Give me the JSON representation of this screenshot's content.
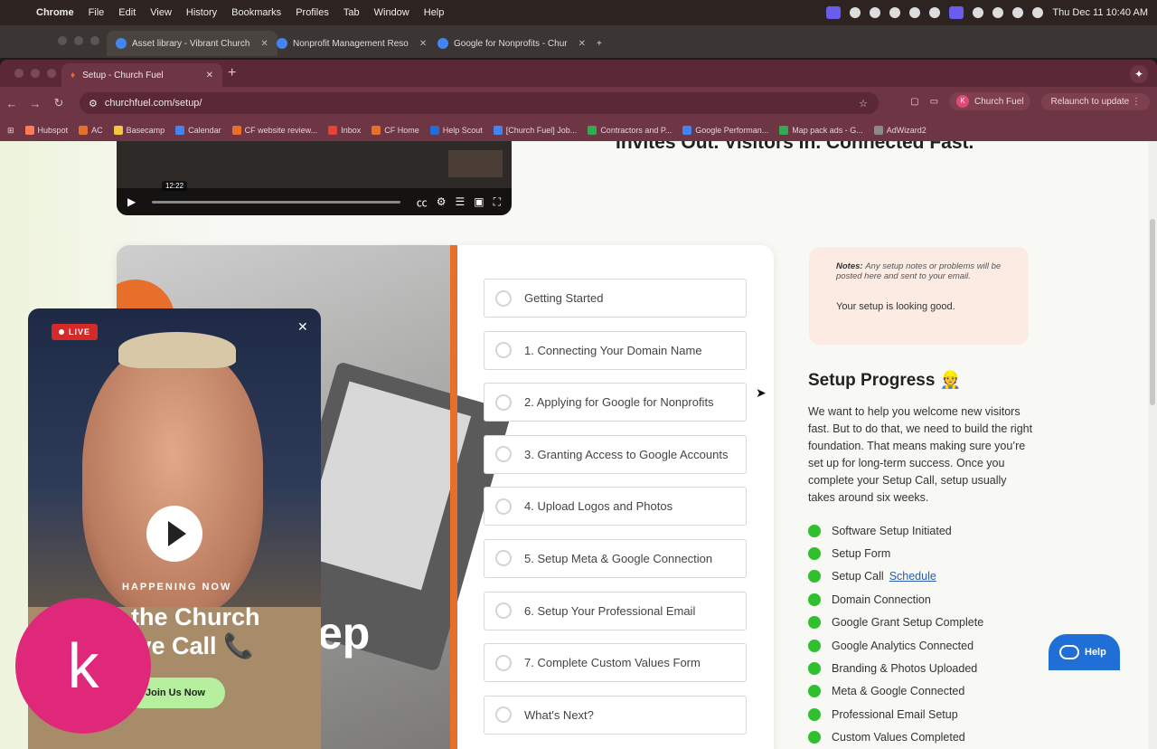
{
  "menubar": {
    "items": [
      "Chrome",
      "File",
      "Edit",
      "View",
      "History",
      "Bookmarks",
      "Profiles",
      "Tab",
      "Window",
      "Help"
    ],
    "datetime": "Thu Dec 11  10:40 AM"
  },
  "back_window_tabs": [
    {
      "title": "Asset library - Vibrant Church",
      "color": "#4285f4"
    },
    {
      "title": "Nonprofit Management Reso",
      "color": "#4285f4"
    },
    {
      "title": "Google for Nonprofits - Chur",
      "color": "#4285f4"
    }
  ],
  "tab": {
    "title": "Setup - Church Fuel"
  },
  "toolbar": {
    "url": "churchfuel.com/setup/",
    "profile_initial": "K",
    "profile_name": "Church Fuel",
    "relaunch": "Relaunch to update"
  },
  "bookmarks": [
    {
      "label": "Hubspot",
      "color": "#ff7a59"
    },
    {
      "label": "AC",
      "color": "#e86e2c"
    },
    {
      "label": "Basecamp",
      "color": "#f5c542"
    },
    {
      "label": "Calendar",
      "color": "#4285f4"
    },
    {
      "label": "CF website review...",
      "color": "#e86e2c"
    },
    {
      "label": "Inbox",
      "color": "#ea4335"
    },
    {
      "label": "CF Home",
      "color": "#e86e2c"
    },
    {
      "label": "Help Scout",
      "color": "#1f6fd6"
    },
    {
      "label": "[Church Fuel] Job...",
      "color": "#4285f4"
    },
    {
      "label": "Contractors and P...",
      "color": "#34a853"
    },
    {
      "label": "Google Performan...",
      "color": "#4285f4"
    },
    {
      "label": "Map pack ads - G...",
      "color": "#34a853"
    },
    {
      "label": "AdWizard2",
      "color": "#8a8a8a"
    }
  ],
  "video": {
    "time": "12:22"
  },
  "headline": "Invites Out. Visitors In. Connected Fast.",
  "steps": [
    "Getting Started",
    "1. Connecting Your Domain Name",
    "2. Applying for Google for Nonprofits",
    "3. Granting Access to Google Accounts",
    "4. Upload Logos and Photos",
    "5. Setup Meta & Google Connection",
    "6. Setup Your Professional Email",
    "7. Complete Custom Values Form",
    "What's Next?"
  ],
  "card_overlay_text": "ep",
  "notes": {
    "label": "Notes:",
    "message": "Any setup notes or problems will be posted here and sent to your email.",
    "status": "Your setup is looking good."
  },
  "progress": {
    "title": "Setup Progress",
    "emoji": "👷",
    "description": "We want to help you welcome new visitors fast. But to do that, we need to build the right foundation. That means making sure you’re set up for long-term success. Once you complete your Setup Call, setup usually takes around six weeks.",
    "items": [
      {
        "label": "Software Setup Initiated",
        "link": ""
      },
      {
        "label": "Setup Form",
        "link": ""
      },
      {
        "label": "Setup Call",
        "link": "Schedule"
      },
      {
        "label": "Domain Connection",
        "link": ""
      },
      {
        "label": "Google Grant Setup Complete",
        "link": ""
      },
      {
        "label": "Google Analytics Connected",
        "link": ""
      },
      {
        "label": "Branding & Photos Uploaded",
        "link": ""
      },
      {
        "label": "Meta & Google Connected",
        "link": ""
      },
      {
        "label": "Professional Email Setup",
        "link": ""
      },
      {
        "label": "Custom Values Completed",
        "link": ""
      }
    ]
  },
  "live_popup": {
    "badge": "LIVE",
    "happening": "HAPPENING NOW",
    "line1": "the Church",
    "line2": "ive Call 📞",
    "join": "Join Us Now"
  },
  "help_button": "Help",
  "avatar_letter": "k"
}
